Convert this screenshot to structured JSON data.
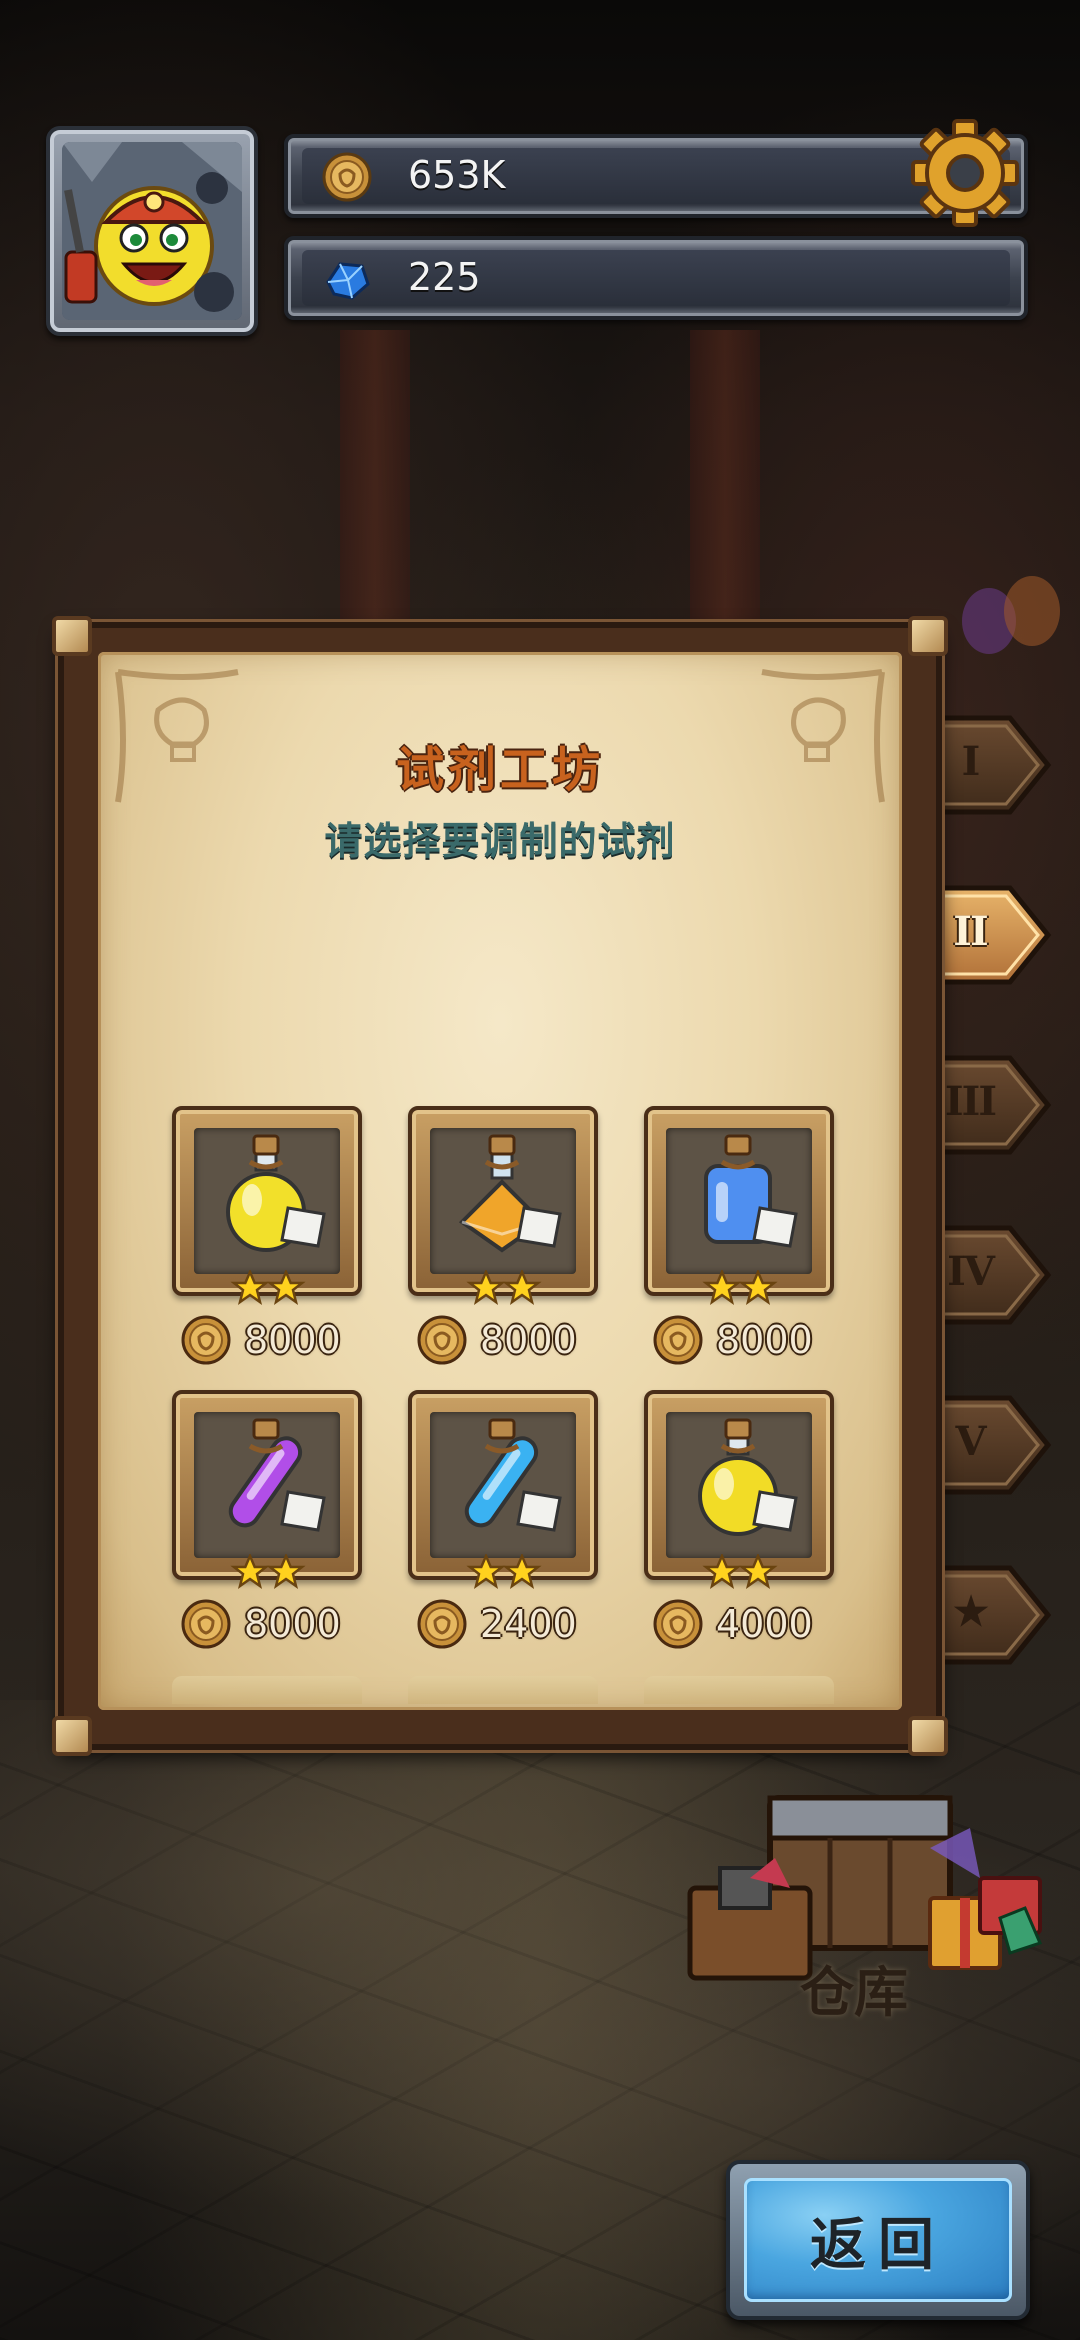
{
  "hud": {
    "coins": "653K",
    "gems": "225",
    "avatar_icon": "miner-smiley-avatar",
    "settings_icon": "gear-icon"
  },
  "panel": {
    "title": "试剂工坊",
    "subtitle": "请选择要调制的试剂"
  },
  "tabs": [
    {
      "label": "I",
      "active": false
    },
    {
      "label": "II",
      "active": true
    },
    {
      "label": "III",
      "active": false
    },
    {
      "label": "IV",
      "active": false
    },
    {
      "label": "V",
      "active": false
    },
    {
      "label": "★",
      "active": false
    }
  ],
  "potions": [
    {
      "price": "8000",
      "stars": 2,
      "icon": "yellow-round-potion-icon",
      "color": "#f2e02a"
    },
    {
      "price": "8000",
      "stars": 2,
      "icon": "amber-square-potion-icon",
      "color": "#f0a52a"
    },
    {
      "price": "8000",
      "stars": 2,
      "icon": "blue-jar-potion-icon",
      "color": "#4f8ff0"
    },
    {
      "price": "8000",
      "stars": 2,
      "icon": "purple-vial-potion-icon",
      "color": "#b14ee8"
    },
    {
      "price": "2400",
      "stars": 2,
      "icon": "cyan-vial-potion-icon",
      "color": "#3ab2f2"
    },
    {
      "price": "4000",
      "stars": 2,
      "icon": "yellow-flask-potion-icon",
      "color": "#f2dc26"
    }
  ],
  "warehouse": {
    "label": "仓库"
  },
  "back_button": {
    "label": "返回"
  }
}
